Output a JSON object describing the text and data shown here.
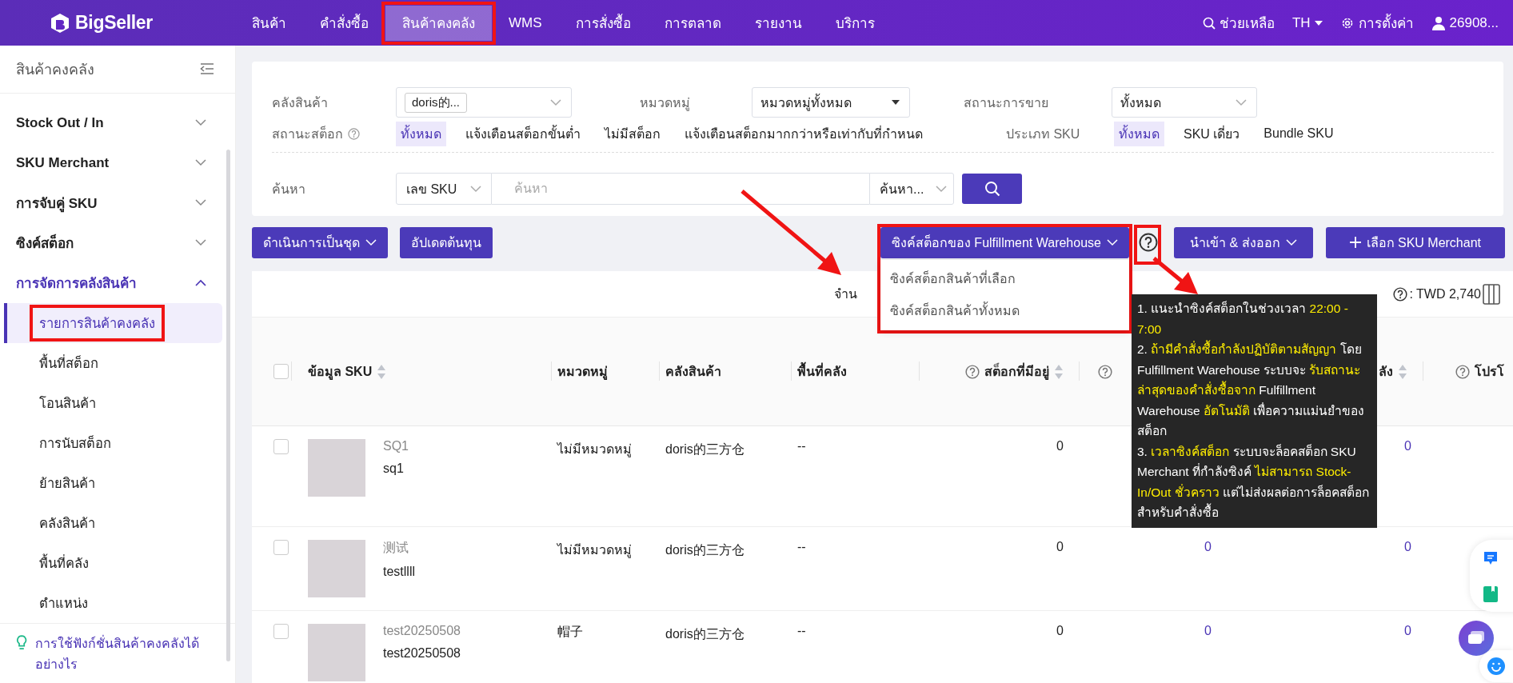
{
  "topbar": {
    "logo": "BigSeller",
    "nav": [
      {
        "label": "สินค้า",
        "selected": false,
        "annotated": false
      },
      {
        "label": "คำสั่งซื้อ",
        "selected": false,
        "annotated": false
      },
      {
        "label": "สินค้าคงคลัง",
        "selected": true,
        "annotated": true
      },
      {
        "label": "WMS",
        "selected": false,
        "annotated": false
      },
      {
        "label": "การสั่งซื้อ",
        "selected": false,
        "annotated": false
      },
      {
        "label": "การตลาด",
        "selected": false,
        "annotated": false
      },
      {
        "label": "รายงาน",
        "selected": false,
        "annotated": false
      },
      {
        "label": "บริการ",
        "selected": false,
        "annotated": false
      }
    ],
    "help": "ช่วยเหลือ",
    "language": "TH",
    "settings": "การตั้งค่า",
    "user": "26908..."
  },
  "sidebar": {
    "title": "สินค้าคงคลัง",
    "groups": [
      {
        "label": "Stock Out / In",
        "expanded": false
      },
      {
        "label": "SKU Merchant",
        "expanded": false
      },
      {
        "label": "การจับคู่ SKU",
        "expanded": false
      },
      {
        "label": "ซิงค์สต็อก",
        "expanded": false
      },
      {
        "label": "การจัดการคลังสินค้า",
        "expanded": true,
        "children": [
          {
            "label": "รายการสินค้าคงคลัง",
            "selected": true,
            "annotated": true
          },
          {
            "label": "พื้นที่สต็อก",
            "selected": false,
            "annotated": false
          },
          {
            "label": "โอนสินค้า",
            "selected": false,
            "annotated": false
          },
          {
            "label": "การนับสต็อก",
            "selected": false,
            "annotated": false
          },
          {
            "label": "ย้ายสินค้า",
            "selected": false,
            "annotated": false
          },
          {
            "label": "คลังสินค้า",
            "selected": false,
            "annotated": false
          },
          {
            "label": "พื้นที่คลัง",
            "selected": false,
            "annotated": false
          },
          {
            "label": "ตำแหน่ง",
            "selected": false,
            "annotated": false
          }
        ]
      }
    ],
    "help_link": "การใช้ฟังก์ชั่นสินค้าคงคลังได้อย่างไร"
  },
  "filters": {
    "warehouse": {
      "label": "คลังสินค้า",
      "tag": "doris的..."
    },
    "category": {
      "label": "หมวดหมู่",
      "value": "หมวดหมู่ทั้งหมด"
    },
    "sales_status": {
      "label": "สถานะการขาย",
      "value": "ทั้งหมด"
    },
    "stock_status": {
      "label": "สถานะสต็อก",
      "options": [
        {
          "label": "ทั้งหมด",
          "selected": true
        },
        {
          "label": "แจ้งเตือนสต็อกขั้นต่ำ",
          "selected": false
        },
        {
          "label": "ไม่มีสต็อก",
          "selected": false
        },
        {
          "label": "แจ้งเตือนสต็อกมากกว่าหรือเท่ากับที่กำหนด",
          "selected": false
        }
      ]
    },
    "sku_type": {
      "label": "ประเภท SKU",
      "options": [
        {
          "label": "ทั้งหมด",
          "selected": true
        },
        {
          "label": "SKU เดี่ยว",
          "selected": false
        },
        {
          "label": "Bundle SKU",
          "selected": false
        }
      ]
    },
    "search": {
      "label": "ค้นหา",
      "field": "เลข SKU",
      "placeholder": "ค้นหา",
      "mode": "ค้นหา..."
    }
  },
  "toolbar": {
    "left": [
      {
        "label": "ดำเนินการเป็นชุด",
        "kind": "dropdown"
      },
      {
        "label": "อัปเดตต้นทุน",
        "kind": "plain"
      }
    ],
    "sync": {
      "label": "ซิงค์สต็อกของ Fulfillment Warehouse",
      "annotated": true,
      "menu": [
        "ซิงค์สต็อกสินค้าที่เลือก",
        "ซิงค์สต็อกสินค้าทั้งหมด"
      ]
    },
    "help_annotated": true,
    "right": [
      {
        "label": "นำเข้า & ส่งออก",
        "kind": "dropdown"
      },
      {
        "label": "เลือก SKU Merchant",
        "kind": "add"
      }
    ]
  },
  "stats": {
    "left": "จำน",
    "right": ": TWD 2,740"
  },
  "table": {
    "all_checked": false,
    "columns": [
      {
        "label": "ข้อมูล SKU",
        "help": false,
        "sortable": true
      },
      {
        "label": "หมวดหมู่",
        "help": false,
        "sortable": false
      },
      {
        "label": "คลังสินค้า",
        "help": false,
        "sortable": false
      },
      {
        "label": "พื้นที่คลัง",
        "help": false,
        "sortable": false
      },
      {
        "label": "สต็อกที่มีอยู่",
        "help": true,
        "sortable": true
      },
      {
        "help": true,
        "sortable": false
      },
      {
        "label": "ลัง",
        "help": false,
        "sortable": true
      },
      {
        "label": "โปรโ",
        "help": true,
        "sortable": false
      }
    ],
    "rows": [
      {
        "checked": false,
        "sku": "SQ1",
        "name": "sq1",
        "category": "ไม่มีหมวดหมู่",
        "warehouse": "doris的三方仓",
        "area": "--",
        "stock": "0",
        "column_7": "0"
      },
      {
        "checked": false,
        "sku": "测试",
        "name": "testllll",
        "category": "ไม่มีหมวดหมู่",
        "warehouse": "doris的三方仓",
        "area": "--",
        "stock": "0",
        "column_6": "0",
        "column_7": "0"
      },
      {
        "checked": false,
        "sku": "test20250508",
        "name": "test20250508",
        "category": "帽子",
        "warehouse": "doris的三方仓",
        "area": "--",
        "stock": "0",
        "column_6": "0",
        "column_7": "0"
      }
    ]
  },
  "tooltip": {
    "paragraphs": [
      [
        {
          "text": "1. แนะนำซิงค์สต็อกในช่วงเวลา ",
          "highlight": false
        },
        {
          "text": "22:00 - 7:00",
          "highlight": true
        }
      ],
      [
        {
          "text": "2. ",
          "highlight": false
        },
        {
          "text": "ถ้ามีคำสั่งซื้อกำลังปฏิบัติตามสัญญา",
          "highlight": true
        },
        {
          "text": " โดย Fulfillment Warehouse ระบบจะ ",
          "highlight": false
        },
        {
          "text": "รับสถานะล่าสุดของคำสั่งซื้อจาก",
          "highlight": true
        },
        {
          "text": " Fulfillment Warehouse ",
          "highlight": false
        },
        {
          "text": "อัตโนมัติ",
          "highlight": true
        },
        {
          "text": " เพื่อความแม่นยำของสต็อก",
          "highlight": false
        }
      ],
      [
        {
          "text": "3. ",
          "highlight": false
        },
        {
          "text": "เวลาซิงค์สต็อก",
          "highlight": true
        },
        {
          "text": " ระบบจะล็อคสต็อก SKU Merchant ที่กำลังซิงค์ ",
          "highlight": false
        },
        {
          "text": "ไม่สามารถ Stock-In/Out ชั่วคราว",
          "highlight": true
        },
        {
          "text": " แต่ไม่ส่งผลต่อการล็อคสต็อกสำหรับคำสั่งซื้อ",
          "highlight": false
        }
      ]
    ]
  }
}
